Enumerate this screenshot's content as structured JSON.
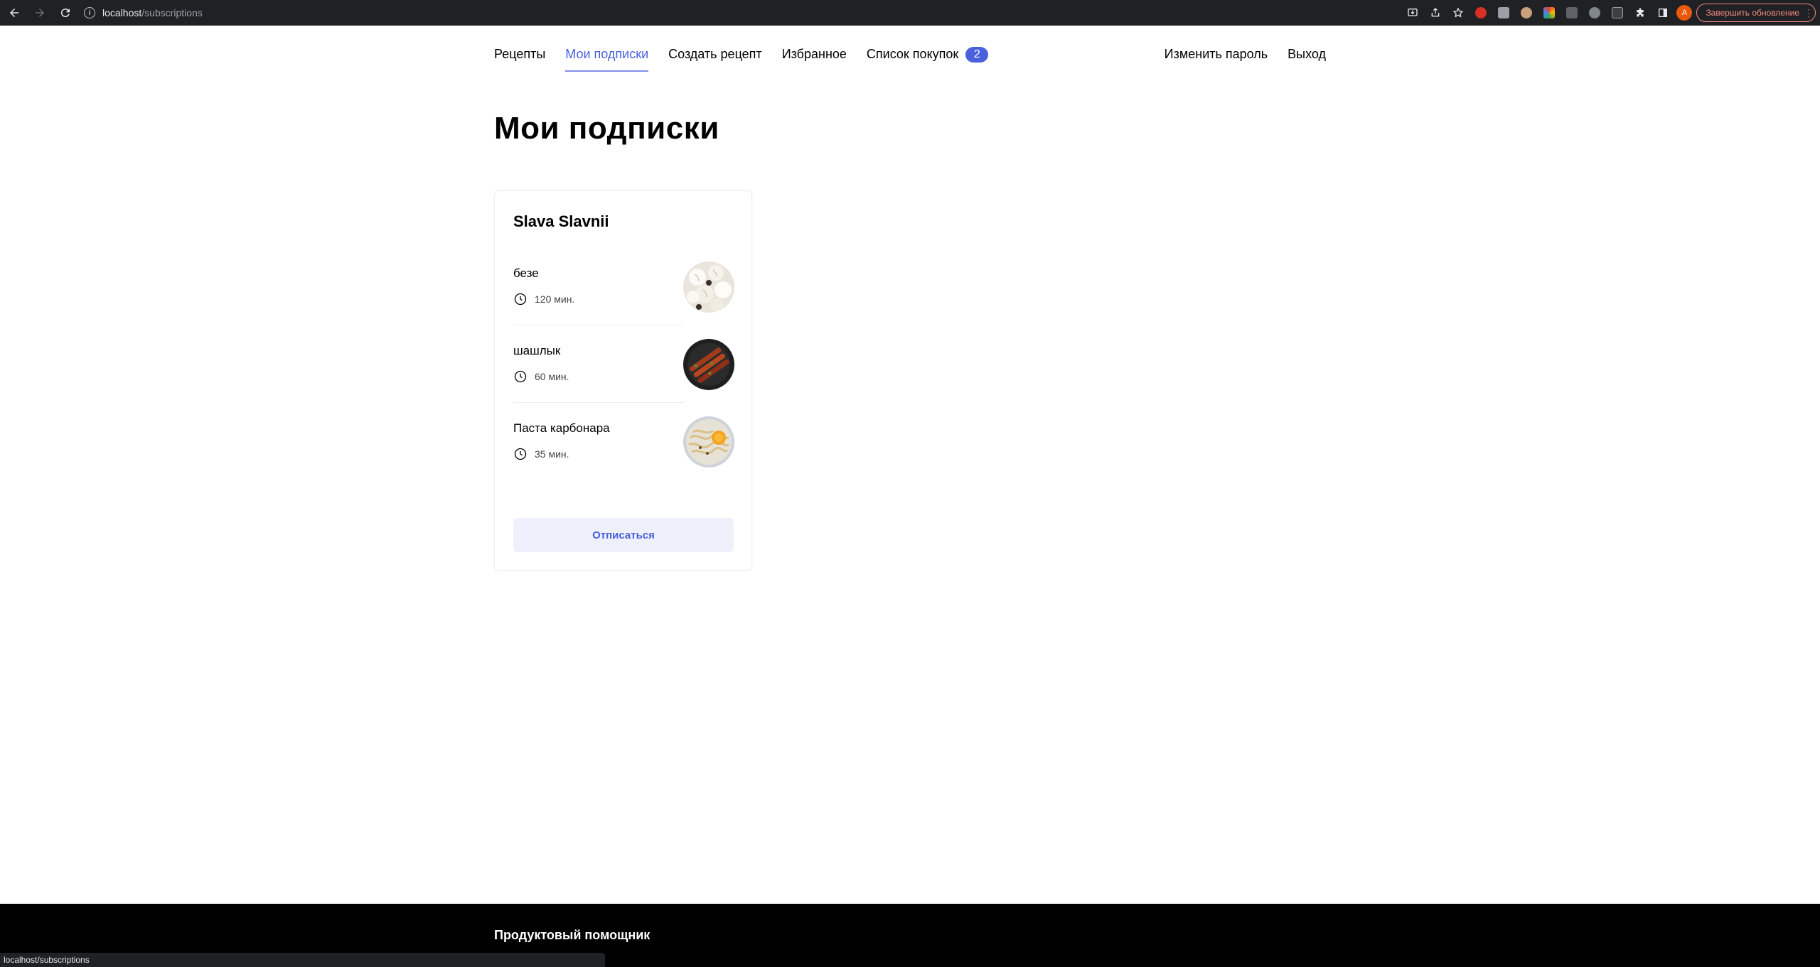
{
  "browser": {
    "url_host": "localhost",
    "url_path": "/subscriptions",
    "update_label": "Завершить обновление",
    "profile_initial": "A",
    "status_url": "localhost/subscriptions"
  },
  "nav": {
    "items": [
      {
        "label": "Рецепты",
        "active": false
      },
      {
        "label": "Мои подписки",
        "active": true
      },
      {
        "label": "Создать рецепт",
        "active": false
      },
      {
        "label": "Избранное",
        "active": false
      },
      {
        "label": "Список покупок",
        "active": false
      }
    ],
    "cart_count": "2",
    "change_password": "Изменить пароль",
    "logout": "Выход"
  },
  "page": {
    "title": "Мои подписки"
  },
  "subscription": {
    "author": "Slava Slavnii",
    "recipes": [
      {
        "name": "безе",
        "time": "120 мин.",
        "image": "meringue"
      },
      {
        "name": "шашлык",
        "time": "60 мин.",
        "image": "shashlik"
      },
      {
        "name": "Паста карбонара",
        "time": "35 мин.",
        "image": "carbonara"
      }
    ],
    "unsubscribe_label": "Отписаться"
  },
  "footer": {
    "brand": "Продуктовый помощник"
  },
  "colors": {
    "accent": "#4a61dd",
    "button_bg": "#eef0fb",
    "footer_bg": "#000000"
  }
}
